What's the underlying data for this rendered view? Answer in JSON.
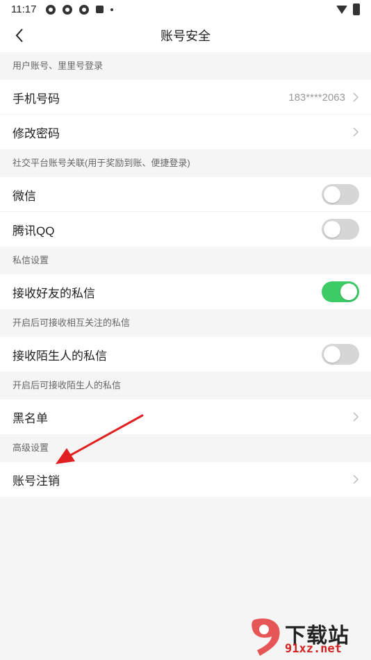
{
  "status_bar": {
    "time": "11:17"
  },
  "header": {
    "title": "账号安全"
  },
  "sections": [
    {
      "header": "用户账号、里里号登录",
      "rows": [
        {
          "label": "手机号码",
          "value": "183****2063",
          "type": "link"
        },
        {
          "label": "修改密码",
          "type": "link"
        }
      ]
    },
    {
      "header": "社交平台账号关联(用于奖励到账、便捷登录)",
      "rows": [
        {
          "label": "微信",
          "type": "toggle",
          "on": false
        },
        {
          "label": "腾讯QQ",
          "type": "toggle",
          "on": false
        }
      ]
    },
    {
      "header": "私信设置",
      "rows": [
        {
          "label": "接收好友的私信",
          "type": "toggle",
          "on": true
        }
      ]
    },
    {
      "header": "开启后可接收相互关注的私信",
      "rows": [
        {
          "label": "接收陌生人的私信",
          "type": "toggle",
          "on": false
        }
      ]
    },
    {
      "header": "开启后可接收陌生人的私信",
      "rows": [
        {
          "label": "黑名单",
          "type": "link"
        }
      ]
    },
    {
      "header": "高级设置",
      "rows": [
        {
          "label": "账号注销",
          "type": "link"
        }
      ]
    }
  ],
  "watermark": {
    "cn": "下载站",
    "en": "91xz.net"
  },
  "colors": {
    "toggle_on": "#3dcb65",
    "toggle_off": "#d6d6d6",
    "annotation_arrow": "#e02020"
  }
}
